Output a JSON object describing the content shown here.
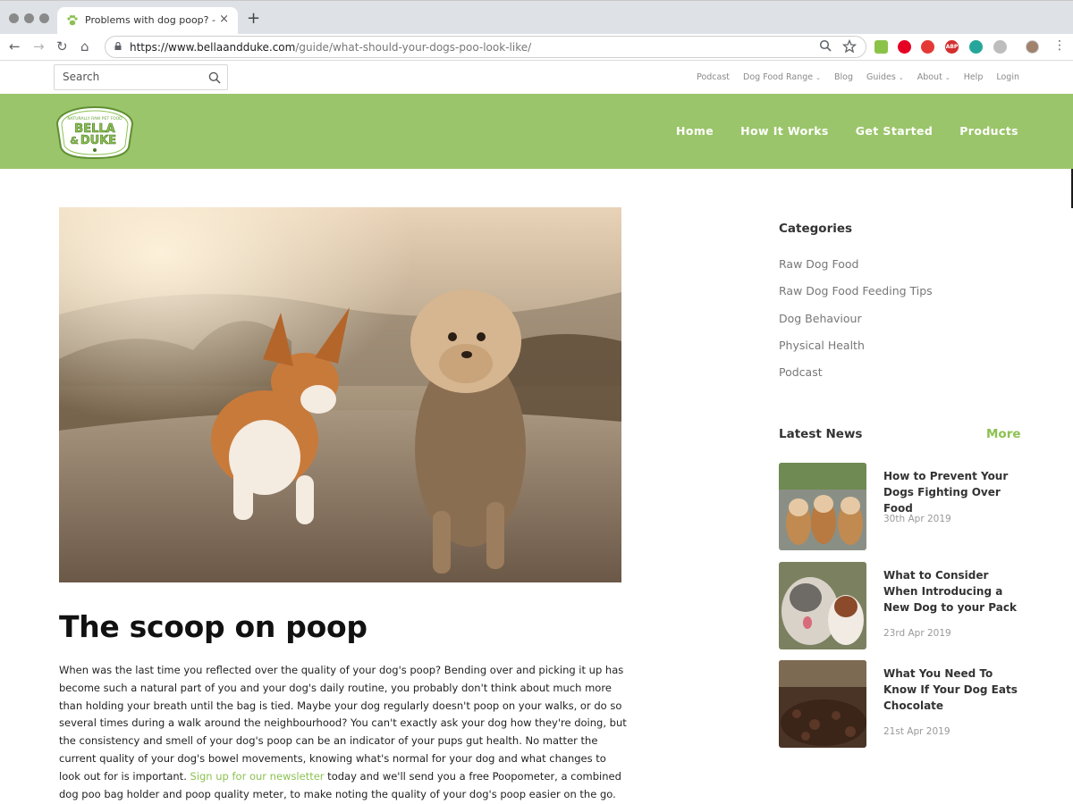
{
  "browser": {
    "tab_title": "Problems with dog poop? - Bel",
    "tab_close": "×",
    "new_tab": "+",
    "url_host": "https://www.bellaandduke.com",
    "url_path": "/guide/what-should-your-dogs-poo-look-like/",
    "nav": {
      "back": "←",
      "forward": "→",
      "reload": "↻",
      "home": "⌂"
    },
    "ext_badge": "ABP",
    "menu": "⋮"
  },
  "utility": {
    "search_placeholder": "Search",
    "links": [
      {
        "label": "Podcast",
        "dropdown": false
      },
      {
        "label": "Dog Food Range",
        "dropdown": true
      },
      {
        "label": "Blog",
        "dropdown": false
      },
      {
        "label": "Guides",
        "dropdown": true
      },
      {
        "label": "About",
        "dropdown": true
      },
      {
        "label": "Help",
        "dropdown": false
      },
      {
        "label": "Login",
        "dropdown": false
      }
    ],
    "dropdown_glyph": "⌄"
  },
  "header": {
    "logo_text_top": "BELLA",
    "logo_text_amp": "&",
    "logo_text_bottom": "DUKE",
    "logo_tagline": "NATURALLY RAW PET FOOD",
    "nav": [
      "Home",
      "How It Works",
      "Get Started",
      "Products"
    ]
  },
  "article": {
    "title": "The scoop on poop",
    "body_before_link": "When was the last time you reflected over the quality of your dog's poop? Bending over and picking it up has become such a natural part of you and your dog's daily routine, you probably don't think about much more than holding your breath until the bag is tied. Maybe your dog regularly doesn't poop on your walks, or do so several times during a walk around the neighbourhood? You can't exactly ask your dog how they're doing, but the consistency and smell of your dog's poop can be an indicator of your pups gut health. No matter the current quality of your dog's bowel movements, knowing what's normal for your dog and what changes to look out for is important. ",
    "link_text": "Sign up for our newsletter",
    "body_after_link": " today and we'll send you a free Poopometer, a combined dog poo bag holder and poop quality meter, to make noting the quality of your dog's poop easier on the go."
  },
  "sidebar": {
    "categories_title": "Categories",
    "categories": [
      "Raw Dog Food",
      "Raw Dog Food Feeding Tips",
      "Dog Behaviour",
      "Physical Health",
      "Podcast"
    ],
    "news_title": "Latest News",
    "more_label": "More",
    "news": [
      {
        "headline": "How to Prevent Your Dogs Fighting Over Food",
        "date": "30th Apr 2019"
      },
      {
        "headline": "What to Consider When Introducing a New Dog to your Pack",
        "date": "23rd Apr 2019"
      },
      {
        "headline": "What You Need To Know If Your Dog Eats Chocolate",
        "date": "21st Apr 2019"
      }
    ]
  },
  "colors": {
    "brand_green": "#9bc56a",
    "link_green": "#8cc152"
  }
}
